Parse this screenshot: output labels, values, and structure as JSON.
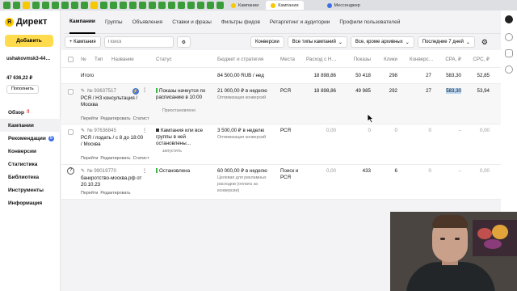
{
  "browser": {
    "tabs": [
      {
        "label": "Кампании",
        "icon": "yandex-icon",
        "active": false
      },
      {
        "label": "Кампании",
        "icon": "yandex-icon",
        "active": true
      },
      {
        "label": "Мессенджер",
        "icon": "messenger-icon",
        "active": false
      }
    ]
  },
  "app": {
    "logo_text": "Директ",
    "accent": "#ffdb4d"
  },
  "sidebar": {
    "add_button": "Добавить",
    "login": "ushakovmsk3-44…",
    "balance": "47 636,22 ₽",
    "topup": "Пополнить",
    "items": [
      {
        "label": "Обзор",
        "alert": "‼"
      },
      {
        "label": "Кампании",
        "active": true
      },
      {
        "label": "Рекомендации",
        "badge": "5"
      },
      {
        "label": "Конверсии"
      },
      {
        "label": "Статистика"
      },
      {
        "label": "Библиотека"
      },
      {
        "label": "Инструменты"
      },
      {
        "label": "Информация"
      }
    ]
  },
  "nav_tabs": [
    "Кампании",
    "Группы",
    "Объявления",
    "Ставки и фразы",
    "Фильтры фидов",
    "Ретаргетинг и аудитории",
    "Профили пользователей"
  ],
  "toolbar": {
    "add_campaign": "+ Кампания",
    "search_placeholder": "Поиск",
    "conversions": "Конверсии",
    "type_filter": "Все типы кампаний",
    "archive_filter": "Все, кроме архивных",
    "period": "Последние 7 дней"
  },
  "table": {
    "headers": {
      "num": "№",
      "type": "Тип",
      "name": "Название",
      "status": "Статус",
      "budget": "Бюджет и стратегия",
      "places": "Места",
      "spend": "Расход с Н…",
      "impressions": "Показы",
      "clicks": "Клики",
      "conversions": "Конверс…",
      "cpa": "CPA, ₽",
      "cpc": "CPC, ₽"
    },
    "total": {
      "label": "Итого",
      "budget": "84 500,00 RUB / нед",
      "spend": "18 898,86",
      "impressions": "50 418",
      "clicks": "298",
      "conversions": "27",
      "cpa": "583,30",
      "cpc": "52,85"
    },
    "rows": [
      {
        "id": "№ 93637517",
        "name": "РСЯ / НЗ консультация / Москва",
        "links": [
          "Перейти",
          "Редактировать",
          "Статист"
        ],
        "status": "Показы начнутся по расписанию в 10:00",
        "status_sub": "Приостановлено",
        "status_mark": "green",
        "budget": "21 000,00 ₽ в неделю",
        "budget_sub": "Оптимизация конверсий",
        "places": "РСЯ",
        "spend": "18 898,86",
        "impressions": "49 985",
        "clicks": "292",
        "conversions": "27",
        "cpa": "583,30",
        "cpc": "53,94"
      },
      {
        "id": "№ 97636845",
        "name": "РСЯ / подать / с 8 до 18:00 / Москва",
        "links": [
          "Перейти",
          "Редактировать",
          "Статист"
        ],
        "status": "Кампания или все группы в ней остановлены…",
        "status_sub": "запустить",
        "status_mark": "black",
        "budget": "3 500,00 ₽ в неделю",
        "budget_sub": "Оптимизация конверсий",
        "places": "РСЯ",
        "spend": "0,00",
        "impressions": "0",
        "clicks": "0",
        "conversions": "0",
        "cpa": "–",
        "cpc": "0,00"
      },
      {
        "id": "№ 99019770",
        "name": "банкротство-москва.рф от 20.10.23",
        "links": [
          "Перейти",
          "Редактировать"
        ],
        "status": "Остановлена",
        "status_sub": "",
        "status_mark": "green",
        "budget": "60 000,00 ₽ в неделю",
        "budget_sub": "Целевая для рекламных расходов (оплата за конверсии)",
        "places": "Поиск и РСЯ",
        "spend": "0,00",
        "impressions": "433",
        "clicks": "6",
        "conversions": "0",
        "cpa": "–",
        "cpc": "0,00"
      }
    ]
  }
}
